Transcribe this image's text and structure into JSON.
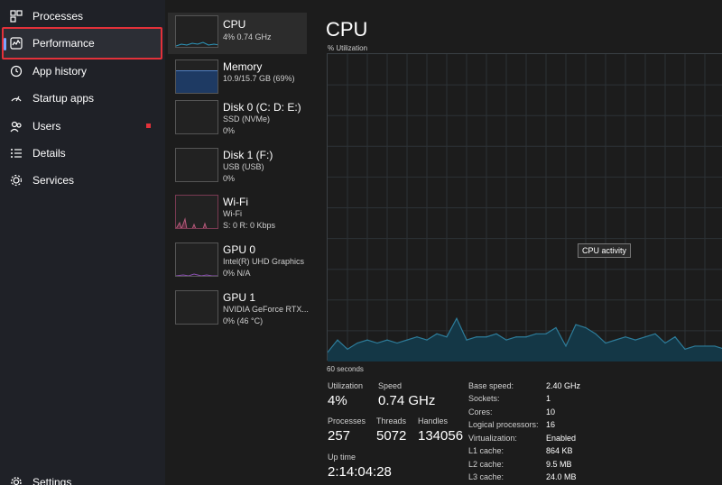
{
  "sidebar": {
    "items": [
      {
        "label": "Processes",
        "icon": "processes-icon"
      },
      {
        "label": "Performance",
        "icon": "performance-icon"
      },
      {
        "label": "App history",
        "icon": "history-icon"
      },
      {
        "label": "Startup apps",
        "icon": "startup-icon"
      },
      {
        "label": "Users",
        "icon": "users-icon"
      },
      {
        "label": "Details",
        "icon": "details-icon"
      },
      {
        "label": "Services",
        "icon": "services-icon"
      }
    ],
    "settings_label": "Settings"
  },
  "devices": [
    {
      "name": "CPU",
      "lines": [
        "4% 0.74 GHz"
      ]
    },
    {
      "name": "Memory",
      "lines": [
        "10.9/15.7 GB (69%)"
      ]
    },
    {
      "name": "Disk 0 (C: D: E:)",
      "lines": [
        "SSD (NVMe)",
        "0%"
      ]
    },
    {
      "name": "Disk 1 (F:)",
      "lines": [
        "USB (USB)",
        "0%"
      ]
    },
    {
      "name": "Wi-Fi",
      "lines": [
        "Wi-Fi",
        "S: 0 R: 0 Kbps"
      ]
    },
    {
      "name": "GPU 0",
      "lines": [
        "Intel(R) UHD Graphics",
        "0% N/A"
      ]
    },
    {
      "name": "GPU 1",
      "lines": [
        "NVIDIA GeForce RTX...",
        "0% (46 °C)"
      ]
    }
  ],
  "main": {
    "title": "CPU",
    "utilization_label": "% Utilization",
    "tooltip": "CPU activity",
    "time_label": "60 seconds",
    "stats": {
      "utilization": {
        "label": "Utilization",
        "value": "4%"
      },
      "speed": {
        "label": "Speed",
        "value": "0.74 GHz"
      },
      "processes": {
        "label": "Processes",
        "value": "257"
      },
      "threads": {
        "label": "Threads",
        "value": "5072"
      },
      "handles": {
        "label": "Handles",
        "value": "134056"
      },
      "uptime": {
        "label": "Up time",
        "value": "2:14:04:28"
      }
    },
    "specs": [
      {
        "label": "Base speed:",
        "value": "2.40 GHz"
      },
      {
        "label": "Sockets:",
        "value": "1"
      },
      {
        "label": "Cores:",
        "value": "10"
      },
      {
        "label": "Logical processors:",
        "value": "16"
      },
      {
        "label": "Virtualization:",
        "value": "Enabled"
      },
      {
        "label": "L1 cache:",
        "value": "864 KB"
      },
      {
        "label": "L2 cache:",
        "value": "9.5 MB"
      },
      {
        "label": "L3 cache:",
        "value": "24.0 MB"
      }
    ]
  },
  "colors": {
    "accent": "#7aa6ff",
    "highlight_border": "#e3313a",
    "cpu_line": "#2d7c9a",
    "cpu_fill": "#143746",
    "memory_fill": "#1e3a63",
    "wifi_line": "#b55d7c",
    "gpu_line": "#8a4fb0"
  },
  "chart_data": {
    "type": "area",
    "title": "CPU",
    "ylabel": "% Utilization",
    "xlabel": "60 seconds",
    "ylim": [
      0,
      100
    ],
    "series": [
      {
        "values": [
          3,
          7,
          4,
          6,
          7,
          6,
          7,
          6,
          7,
          8,
          7,
          9,
          8,
          14,
          7,
          8,
          8,
          9,
          7,
          8,
          8,
          9,
          9,
          11,
          5,
          12,
          11,
          9,
          6,
          7,
          8,
          7,
          8,
          9,
          6,
          8,
          4,
          5,
          5,
          5,
          4
        ]
      }
    ]
  }
}
